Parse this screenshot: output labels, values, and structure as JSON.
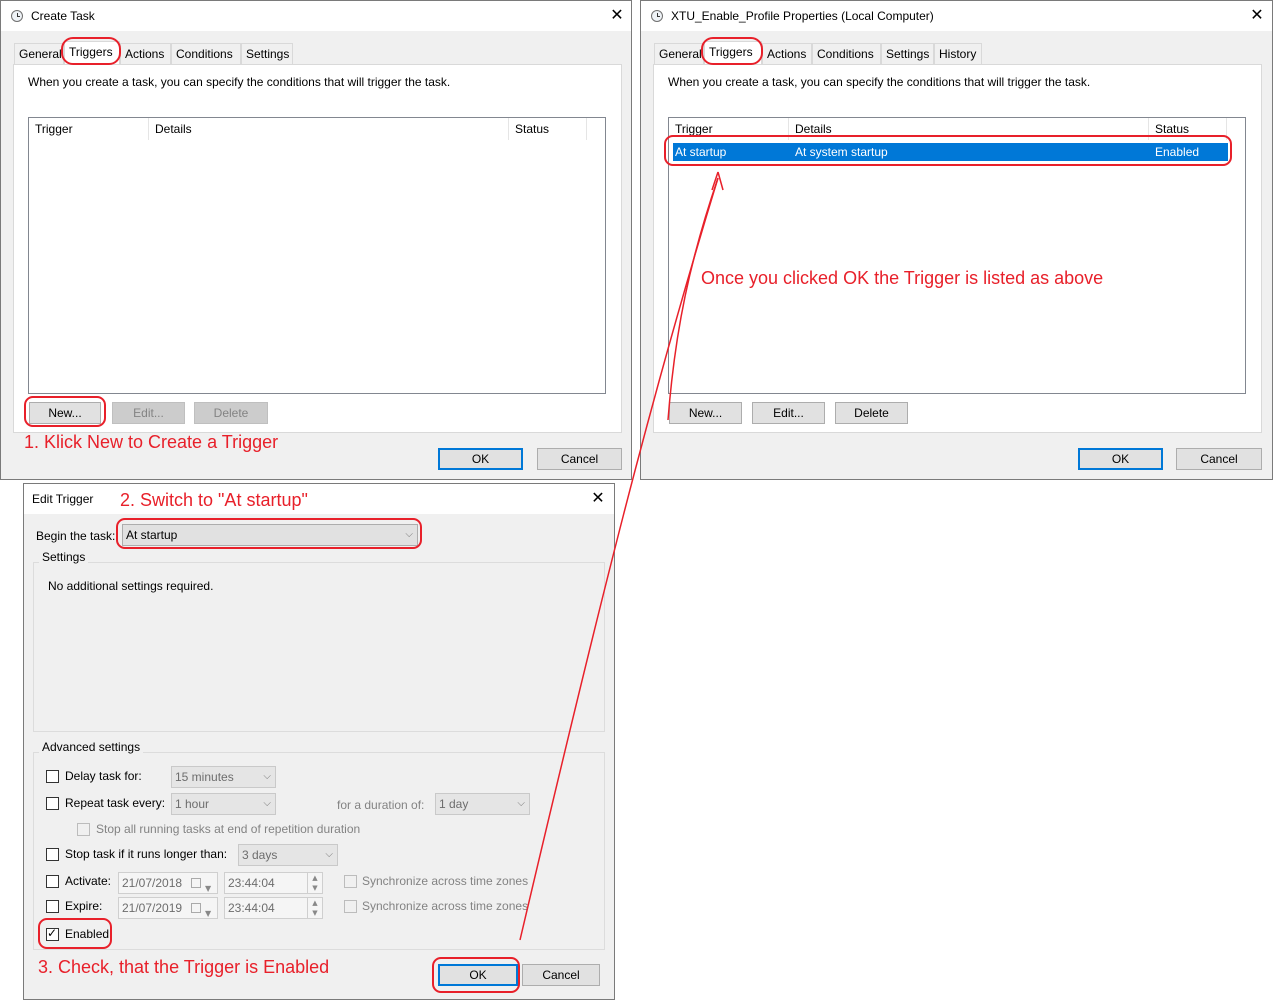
{
  "create_task": {
    "title": "Create Task",
    "tabs": [
      "General",
      "Triggers",
      "Actions",
      "Conditions",
      "Settings"
    ],
    "description": "When you create a task, you can specify the conditions that will trigger the task.",
    "columns": [
      "Trigger",
      "Details",
      "Status"
    ],
    "buttons": {
      "new": "New...",
      "edit": "Edit...",
      "delete": "Delete",
      "ok": "OK",
      "cancel": "Cancel"
    }
  },
  "properties": {
    "title": "XTU_Enable_Profile Properties (Local Computer)",
    "tabs": [
      "General",
      "Triggers",
      "Actions",
      "Conditions",
      "Settings",
      "History"
    ],
    "description": "When you create a task, you can specify the conditions that will trigger the task.",
    "columns": [
      "Trigger",
      "Details",
      "Status"
    ],
    "rows": [
      {
        "trigger": "At startup",
        "details": "At system startup",
        "status": "Enabled"
      }
    ],
    "buttons": {
      "new": "New...",
      "edit": "Edit...",
      "delete": "Delete",
      "ok": "OK",
      "cancel": "Cancel"
    }
  },
  "edit_trigger": {
    "title": "Edit Trigger",
    "begin_label": "Begin the task:",
    "begin_value": "At startup",
    "settings_label": "Settings",
    "settings_text": "No additional settings required.",
    "advanced_label": "Advanced settings",
    "delay_label": "Delay task for:",
    "delay_value": "15 minutes",
    "repeat_label": "Repeat task every:",
    "repeat_value": "1 hour",
    "duration_label": "for a duration of:",
    "duration_value": "1 day",
    "stop_all_label": "Stop all running tasks at end of repetition duration",
    "stop_if_label": "Stop task if it runs longer than:",
    "stop_if_value": "3 days",
    "activate_label": "Activate:",
    "activate_date": "21/07/2018",
    "activate_time": "23:44:04",
    "expire_label": "Expire:",
    "expire_date": "21/07/2019",
    "expire_time": "23:44:04",
    "sync_label": "Synchronize across time zones",
    "enabled_label": "Enabled",
    "enabled": true,
    "buttons": {
      "ok": "OK",
      "cancel": "Cancel"
    }
  },
  "annotations": {
    "step1": "1. Klick New to Create a Trigger",
    "step2": "2. Switch to \"At startup\"",
    "step3": "3. Check, that the Trigger is Enabled",
    "note": "Once you clicked OK the Trigger is listed as above"
  },
  "colors": {
    "annotation": "#e8202a",
    "selection": "#0078d7",
    "dialog_bg": "#f0f0f0"
  }
}
